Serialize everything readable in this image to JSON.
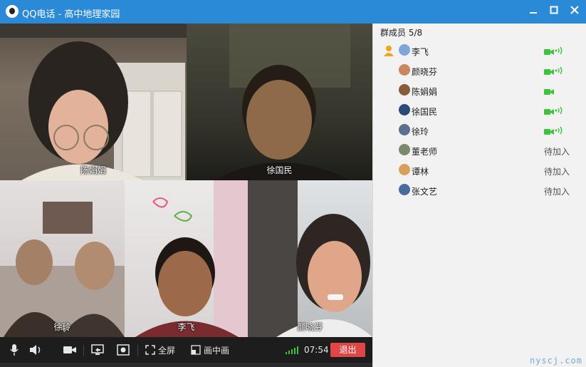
{
  "window": {
    "title": "QQ电话 - 高中地理家园",
    "accent": "#2b8ad8"
  },
  "videos": [
    {
      "name": "陈娟娟"
    },
    {
      "name": "徐国民"
    },
    {
      "name": "徐玲"
    },
    {
      "name": "李飞"
    },
    {
      "name": "颜晓芬"
    }
  ],
  "toolbar": {
    "fullscreen_label": "全屏",
    "pip_label": "画中画",
    "timer": "07:54",
    "exit_label": "退出",
    "exit_color": "#e04646",
    "signal_color": "#3cc43c"
  },
  "panel": {
    "header": "群成员 5/8",
    "members": [
      {
        "name": "李飞",
        "status": "",
        "camera": true,
        "audio": true,
        "host": true
      },
      {
        "name": "颜晓芬",
        "status": "",
        "camera": true,
        "audio": true
      },
      {
        "name": "陈娟娟",
        "status": "",
        "camera": true,
        "audio": false
      },
      {
        "name": "徐国民",
        "status": "",
        "camera": true,
        "audio": true
      },
      {
        "name": "徐玲",
        "status": "",
        "camera": true,
        "audio": true
      },
      {
        "name": "董老师",
        "status": "待加入",
        "camera": false,
        "audio": false
      },
      {
        "name": "谭林",
        "status": "待加入",
        "camera": false,
        "audio": false
      },
      {
        "name": "张文艺",
        "status": "待加入",
        "camera": false,
        "audio": false
      }
    ]
  },
  "watermark": "nyscj.com"
}
